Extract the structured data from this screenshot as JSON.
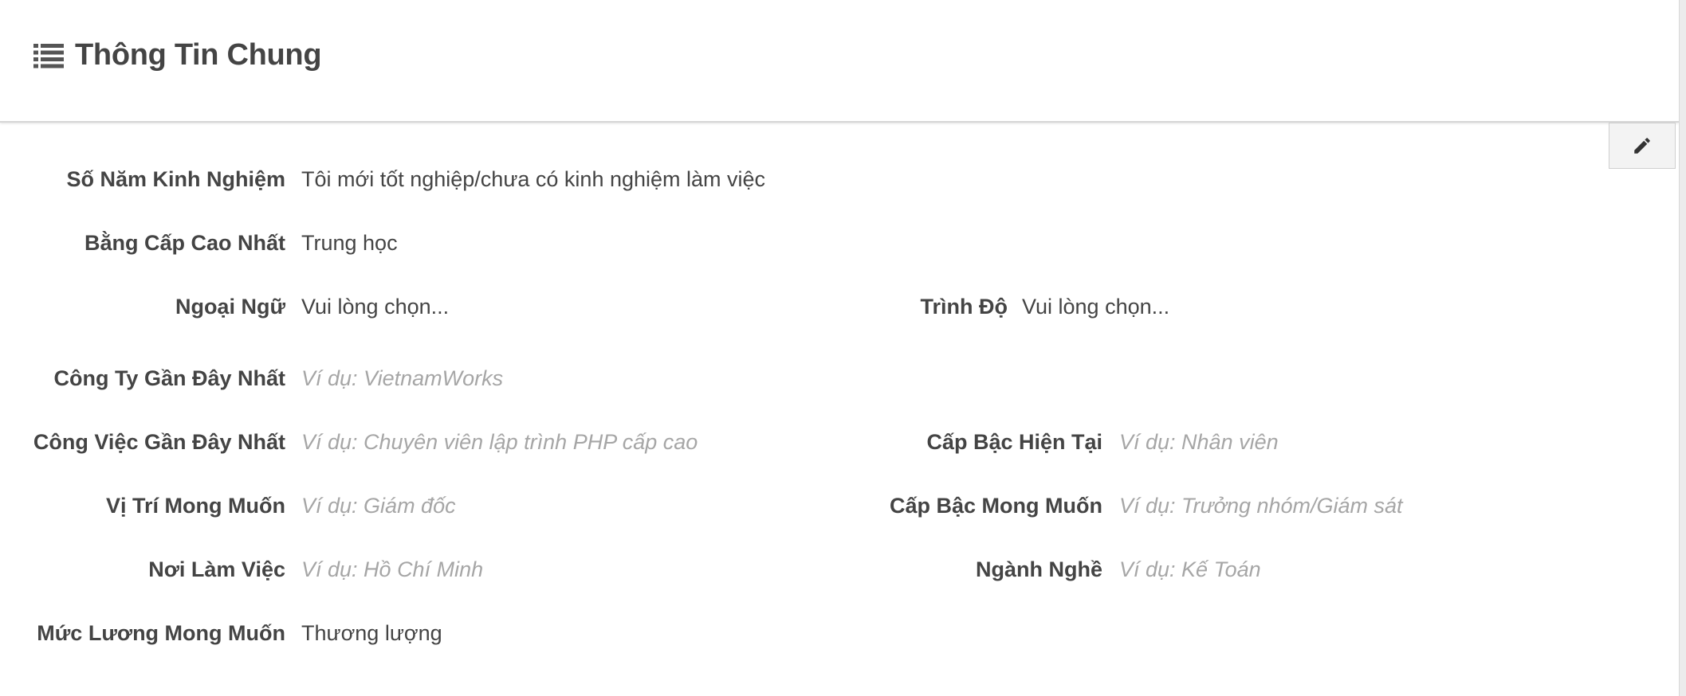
{
  "header": {
    "title": "Thông Tin Chung",
    "icon": "list-icon"
  },
  "edit_button": {
    "icon": "pencil-icon"
  },
  "fields": {
    "experience": {
      "label": "Số Năm Kinh Nghiệm",
      "value": "Tôi mới tốt nghiệp/chưa có kinh nghiệm làm việc"
    },
    "degree": {
      "label": "Bằng Cấp Cao Nhất",
      "value": "Trung học"
    },
    "language": {
      "label": "Ngoại Ngữ",
      "value": "Vui lòng chọn..."
    },
    "language_level": {
      "label": "Trình Độ",
      "value": "Vui lòng chọn..."
    },
    "recent_company": {
      "label": "Công Ty Gần Đây Nhất",
      "placeholder": "Ví dụ: VietnamWorks"
    },
    "recent_job": {
      "label": "Công Việc Gần Đây Nhất",
      "placeholder": "Ví dụ: Chuyên viên lập trình PHP cấp cao"
    },
    "current_level": {
      "label": "Cấp Bậc Hiện Tại",
      "placeholder": "Ví dụ: Nhân viên"
    },
    "desired_position": {
      "label": "Vị Trí Mong Muốn",
      "placeholder": "Ví dụ: Giám đốc"
    },
    "desired_level": {
      "label": "Cấp Bậc Mong Muốn",
      "placeholder": "Ví dụ: Trưởng nhóm/Giám sát"
    },
    "work_location": {
      "label": "Nơi Làm Việc",
      "placeholder": "Ví dụ: Hồ Chí Minh"
    },
    "industry": {
      "label": "Ngành Nghề",
      "placeholder": "Ví dụ: Kế Toán"
    },
    "desired_salary": {
      "label": "Mức Lương Mong Muốn",
      "value": "Thương lượng"
    }
  },
  "colors": {
    "text": "#444444",
    "placeholder": "#a6a6a6",
    "border": "#d6d6d6",
    "button_bg": "#f3f3f3"
  }
}
